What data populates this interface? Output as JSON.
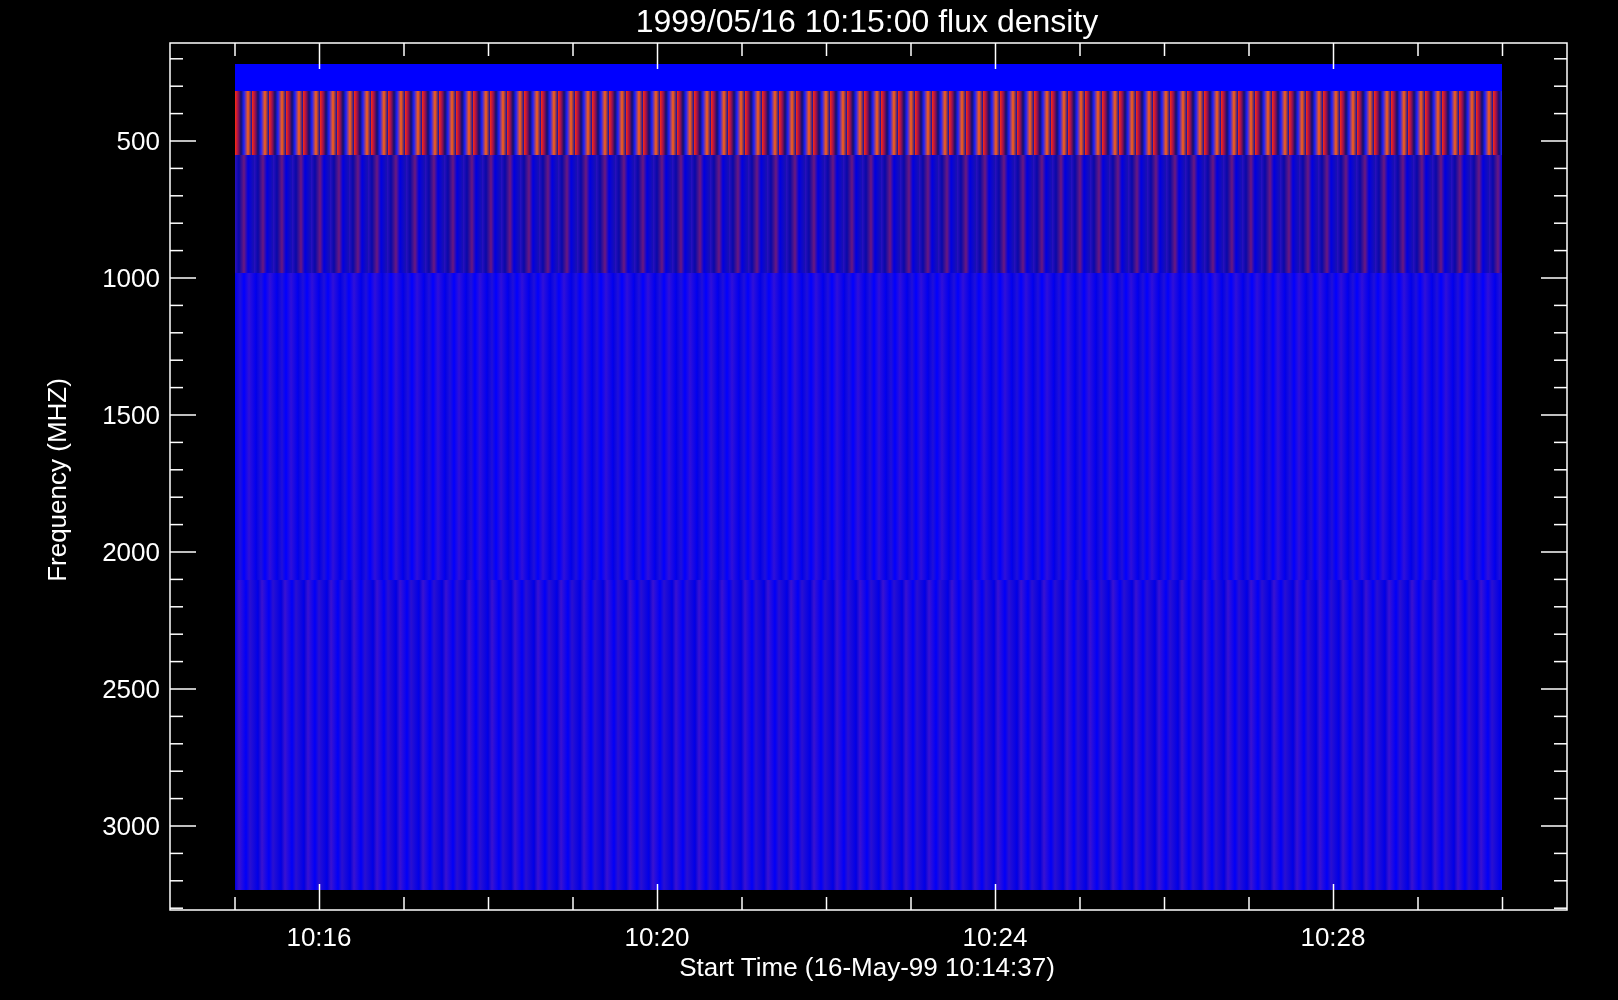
{
  "title": "1999/05/16 10:15:00 flux density",
  "y_axis": {
    "label": "Frequency (MHZ)",
    "ticks": [
      "500",
      "1000",
      "1500",
      "2000",
      "2500",
      "3000"
    ]
  },
  "x_axis": {
    "label": "Start Time (16-May-99 10:14:37)",
    "ticks": [
      "10:16",
      "10:20",
      "10:24",
      "10:28"
    ]
  }
}
